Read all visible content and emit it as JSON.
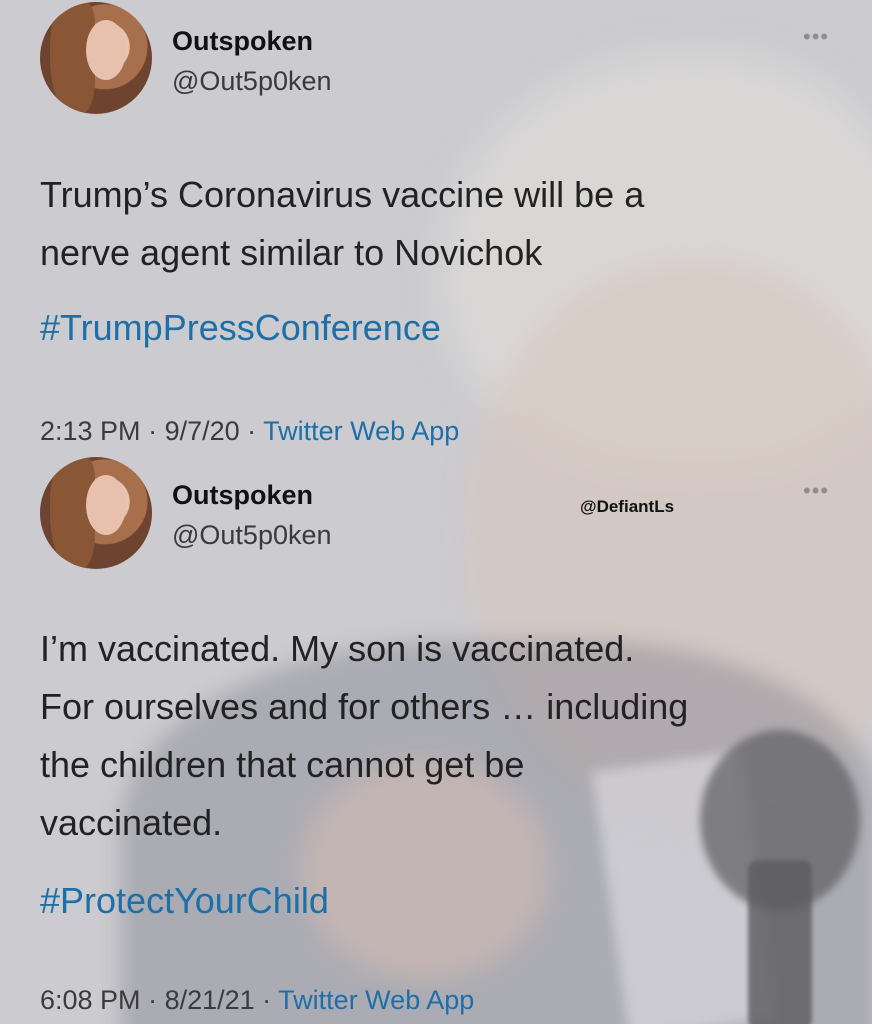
{
  "tweets": [
    {
      "display_name": "Outspoken",
      "handle": "@Out5p0ken",
      "more_icon": "•••",
      "text_lines": [
        "Trump’s Coronavirus vaccine will be a",
        "nerve agent similar to Novichok"
      ],
      "hashtag": "#TrumpPressConference",
      "time": "2:13 PM",
      "date": "9/7/20",
      "source": "Twitter Web App"
    },
    {
      "display_name": "Outspoken",
      "handle": "@Out5p0ken",
      "more_icon": "•••",
      "text_lines": [
        "I’m vaccinated. My son is vaccinated.",
        "For ourselves and for others … including",
        "the children that cannot get be",
        "vaccinated."
      ],
      "hashtag": "#ProtectYourChild",
      "time": "6:08 PM",
      "date": "8/21/21",
      "source": "Twitter Web App"
    }
  ],
  "watermark": "@DefiantLs",
  "separator": " · ",
  "colors": {
    "link": "#1d6fa8",
    "text": "#222222"
  }
}
